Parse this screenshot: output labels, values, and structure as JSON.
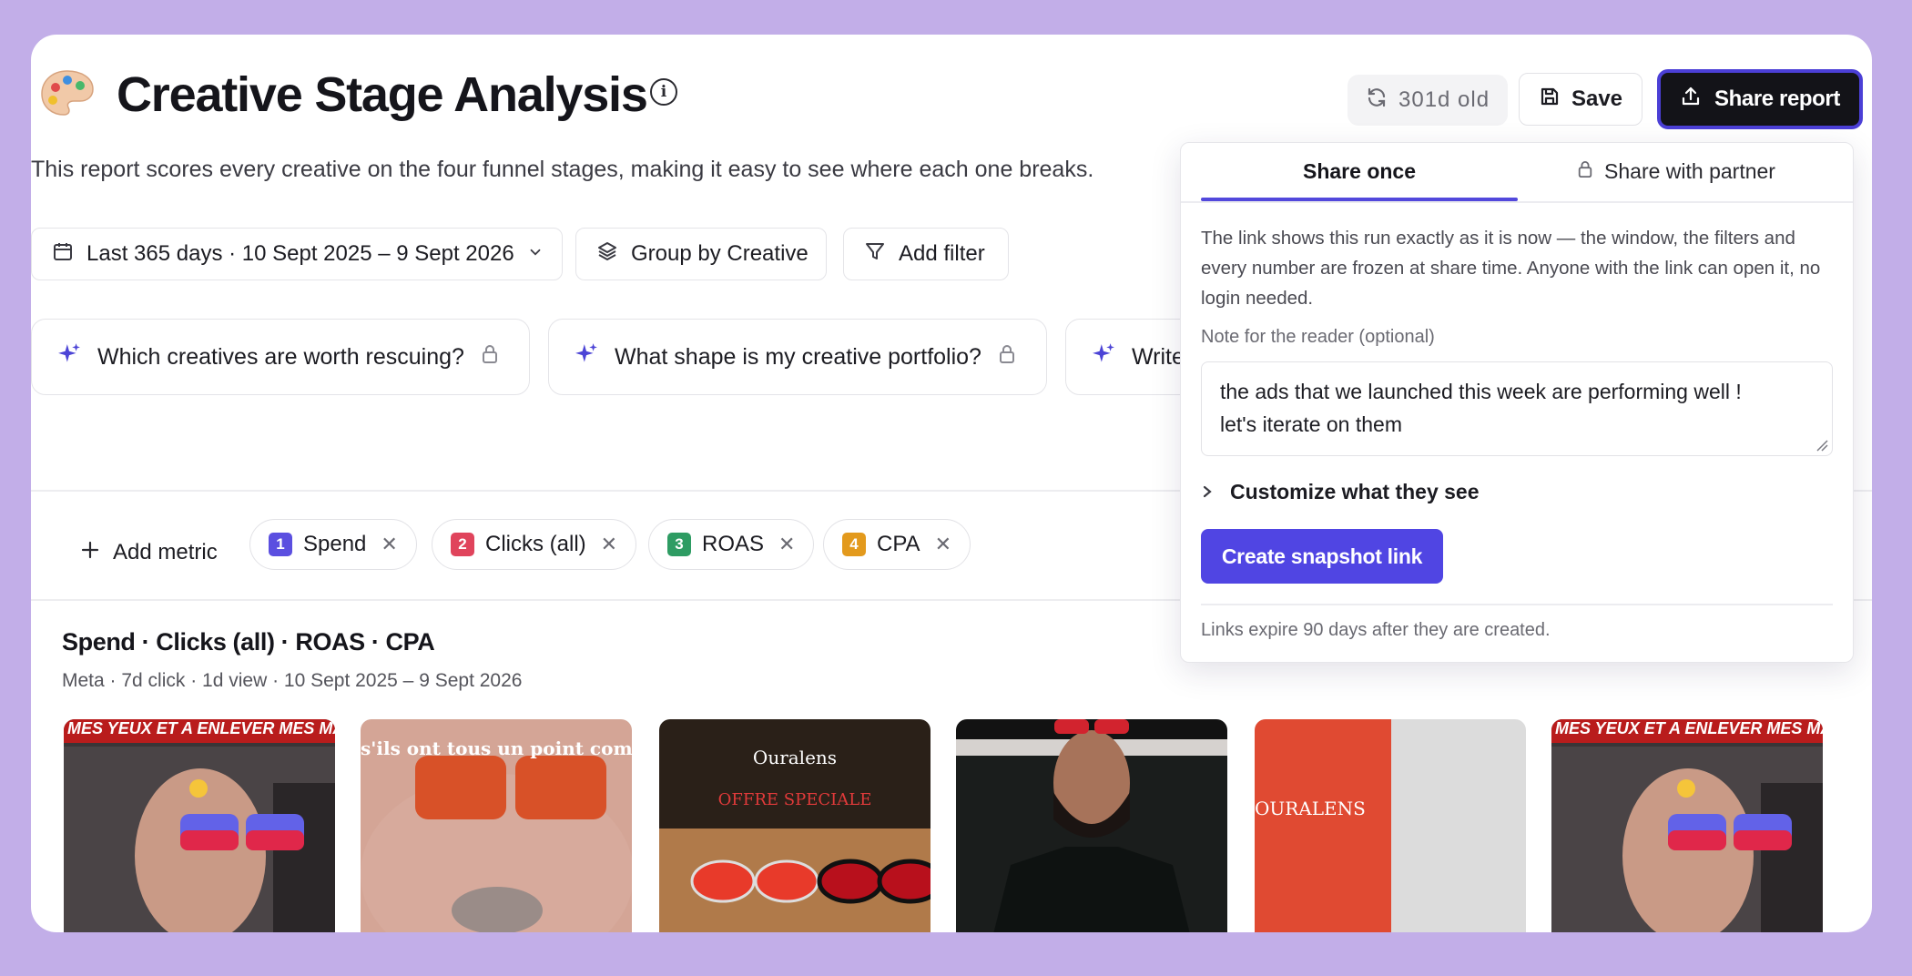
{
  "header": {
    "title": "Creative Stage Analysis",
    "description": "This report scores every creative on the four funnel stages, making it easy to see where each one breaks.",
    "info_glyph": "i",
    "age_label": "301d old",
    "save_label": "Save",
    "share_label": "Share report"
  },
  "filters": {
    "date_range": "Last 365 days · 10 Sept 2025 – 9 Sept 2026",
    "group_by": "Group by Creative",
    "add_filter": "Add filter"
  },
  "questions": [
    {
      "label": "Which creatives are worth rescuing?"
    },
    {
      "label": "What shape is my creative portfolio?"
    },
    {
      "label": "Write"
    }
  ],
  "metrics": {
    "add_label": "Add metric",
    "items": [
      {
        "num": "1",
        "label": "Spend",
        "color": "#5b4fe0"
      },
      {
        "num": "2",
        "label": "Clicks (all)",
        "color": "#e0445c"
      },
      {
        "num": "3",
        "label": "ROAS",
        "color": "#2e9c63"
      },
      {
        "num": "4",
        "label": "CPA",
        "color": "#e39a1d"
      }
    ]
  },
  "section": {
    "title": "Spend · Clicks (all) · ROAS · CPA",
    "subtitle": "Meta · 7d click · 1d view · 10 Sept 2025 – 9 Sept 2026"
  },
  "thumbnails": [
    {
      "caption": "MES YEUX ET A ENLEVER MES MAUX"
    },
    {
      "caption": "s'ils ont tous un point commu"
    },
    {
      "caption": "Ouralens",
      "caption2": "OFFRE SPECIALE"
    },
    {
      "caption": ""
    },
    {
      "caption": "OURALENS"
    },
    {
      "caption": "MES YEUX ET A ENLEVER MES MAUX"
    }
  ],
  "share_panel": {
    "tab_once": "Share once",
    "tab_partner": "Share with partner",
    "description": "The link shows this run exactly as it is now — the window, the filters and every number are frozen at share time. Anyone with the link can open it, no login needed.",
    "note_label": "Note for the reader (optional)",
    "note_line1": "the ads that we launched this week are performing well !",
    "note_line2": "let's iterate on them",
    "customize_label": "Customize what they see",
    "create_label": "Create snapshot link",
    "footnote": "Links expire 90 days after they are created."
  },
  "colors": {
    "background": "#c2aee8",
    "accent": "#5045e3",
    "dark_button": "#131318"
  }
}
